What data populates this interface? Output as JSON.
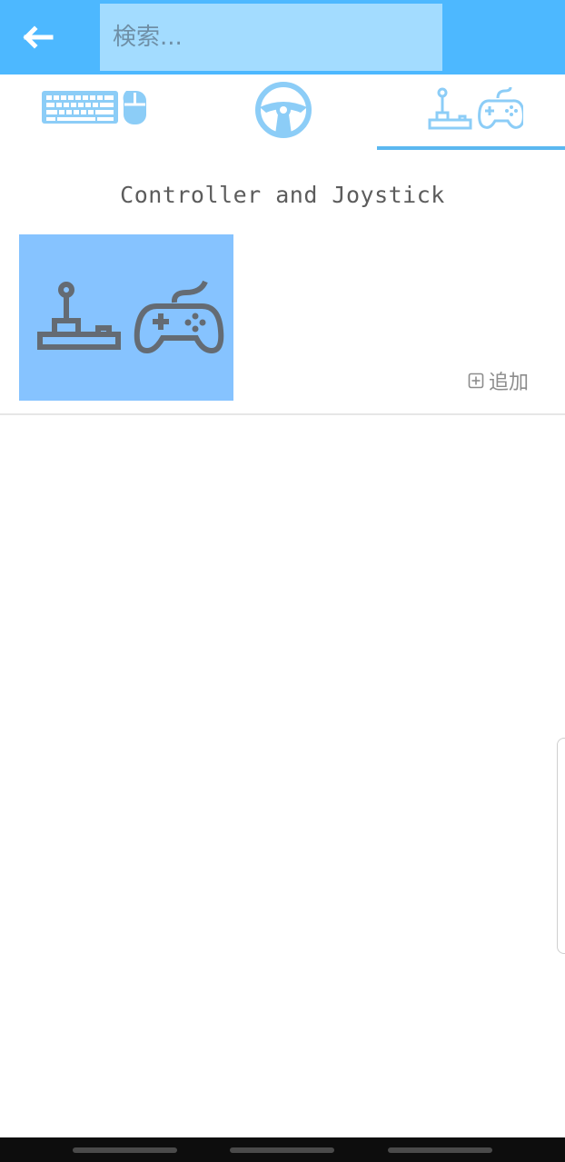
{
  "topbar": {
    "background": "#4db8ff",
    "back_icon": "arrow-left-icon",
    "search": {
      "value": "",
      "placeholder": "検索..."
    }
  },
  "tabs": [
    {
      "icon": "keyboard-mouse-icon",
      "selected": false
    },
    {
      "icon": "steering-wheel-icon",
      "selected": false
    },
    {
      "icon": "joystick-gamepad-icon",
      "selected": true
    }
  ],
  "accent_color": "#5bb8f0",
  "section": {
    "title": "Controller and Joystick",
    "tile_icon": "joystick-gamepad-icon",
    "tile_color": "#86c3ff",
    "add": {
      "icon": "plus-square-icon",
      "label": "追加"
    }
  },
  "system_nav": {
    "buttons": [
      "recent-apps",
      "home",
      "back"
    ]
  }
}
